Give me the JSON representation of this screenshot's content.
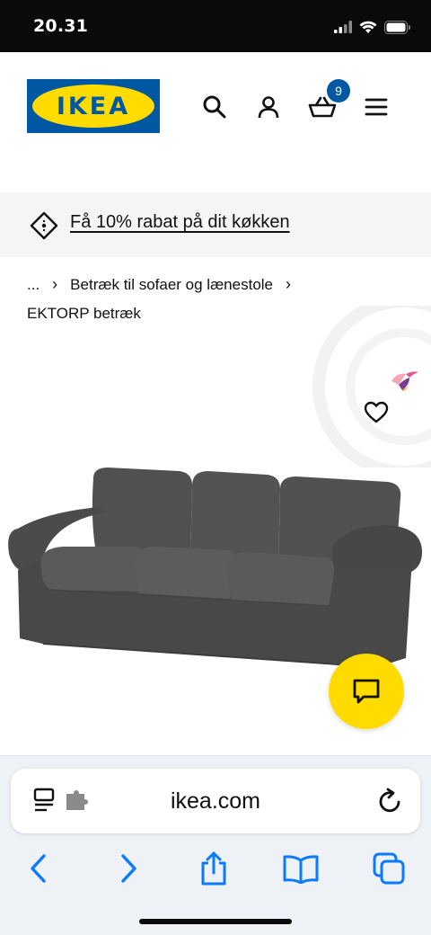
{
  "status": {
    "time": "20.31"
  },
  "header": {
    "logo_text": "IKEA",
    "cart_count": "9",
    "icons": [
      "search-icon",
      "user-icon",
      "cart-icon",
      "menu-icon"
    ]
  },
  "promo": {
    "text": "Få 10% rabat på dit køkken",
    "icon": "price-tag-icon"
  },
  "breadcrumb": {
    "ellipsis": "...",
    "category": "Betræk til sofaer og lænestole"
  },
  "product": {
    "name": "EKTORP betræk"
  },
  "browser": {
    "url": "ikea.com"
  },
  "colors": {
    "ikea_blue": "#0058a3",
    "ikea_yellow": "#ffdb00",
    "ios_blue": "#0a7aff",
    "sofa_gray": "#4a4a4a"
  }
}
